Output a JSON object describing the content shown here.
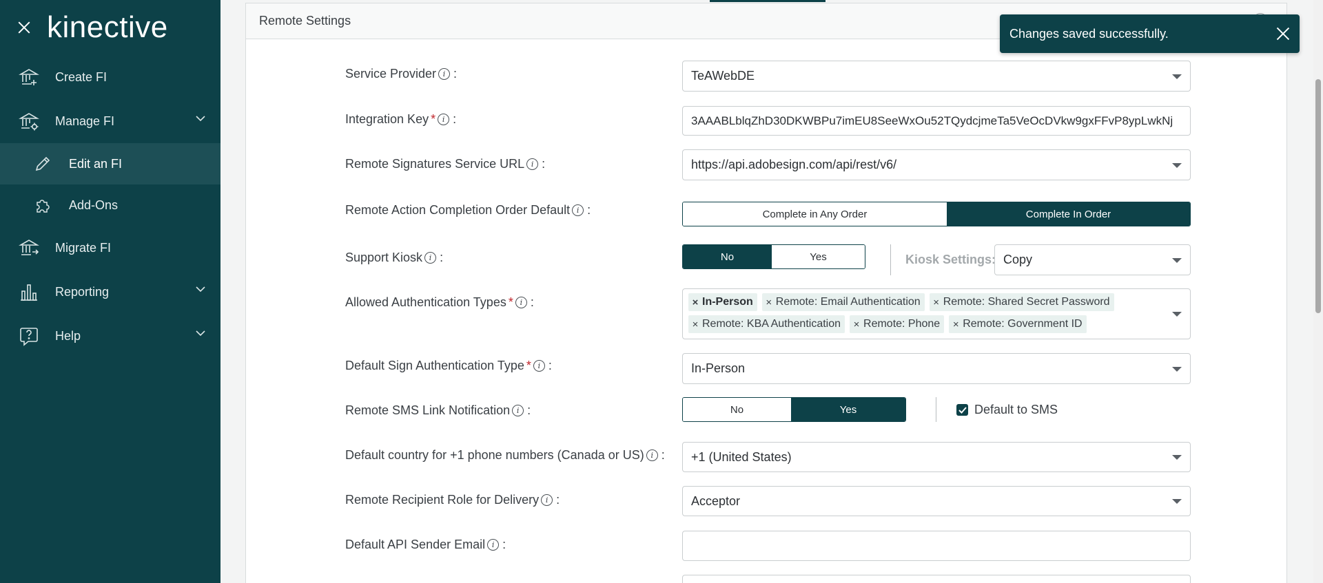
{
  "sidebar": {
    "logo": "kinective",
    "items": [
      {
        "label": "Create FI",
        "icon": "bank-plus-icon"
      },
      {
        "label": "Manage FI",
        "icon": "bank-gear-icon"
      },
      {
        "label": "Edit an FI",
        "icon": "pencil-icon"
      },
      {
        "label": "Add-Ons",
        "icon": "puzzle-icon"
      },
      {
        "label": "Migrate FI",
        "icon": "bank-arrow-icon"
      },
      {
        "label": "Reporting",
        "icon": "bar-chart-icon"
      },
      {
        "label": "Help",
        "icon": "question-bubble-icon"
      }
    ]
  },
  "panel": {
    "title": "Remote Settings"
  },
  "toast": {
    "message": "Changes saved successfully."
  },
  "fields": {
    "service_provider": {
      "label": "Service Provider",
      "value": "TeAWebDE"
    },
    "integration_key": {
      "label": "Integration Key",
      "value": "3AAABLblqZhD30DKWBPu7imEU8SeeWxOu52TQydcjmeTa5VeOcDVkw9gxFFvP8ypLwkNj"
    },
    "remote_url": {
      "label": "Remote Signatures Service URL",
      "value": "https://api.adobesign.com/api/rest/v6/"
    },
    "completion_order": {
      "label": "Remote Action Completion Order Default",
      "options": [
        "Complete in Any Order",
        "Complete In Order"
      ],
      "selected": "Complete In Order"
    },
    "support_kiosk": {
      "label": "Support Kiosk",
      "options": [
        "No",
        "Yes"
      ],
      "selected": "No",
      "kiosk_settings_label": "Kiosk Settings:",
      "kiosk_settings_value": "Copy"
    },
    "auth_types": {
      "label": "Allowed Authentication Types",
      "tags": [
        "In-Person",
        "Remote: Email Authentication",
        "Remote: Shared Secret Password",
        "Remote: KBA Authentication",
        "Remote: Phone",
        "Remote: Government ID"
      ]
    },
    "default_sign_auth": {
      "label": "Default Sign Authentication Type",
      "value": "In-Person"
    },
    "sms_notification": {
      "label": "Remote SMS Link Notification",
      "options": [
        "No",
        "Yes"
      ],
      "selected": "Yes",
      "checkbox_label": "Default to SMS",
      "checkbox_checked": true
    },
    "default_country": {
      "label": "Default country for +1 phone numbers (Canada or US)",
      "value": "+1 (United States)"
    },
    "recipient_role": {
      "label": "Remote Recipient Role for Delivery",
      "value": "Acceptor"
    },
    "api_sender_email": {
      "label": "Default API Sender Email",
      "value": ""
    }
  },
  "colors": {
    "primary": "#0d4148",
    "required": "#c0272d",
    "tag_bg": "#e8f1ef"
  }
}
